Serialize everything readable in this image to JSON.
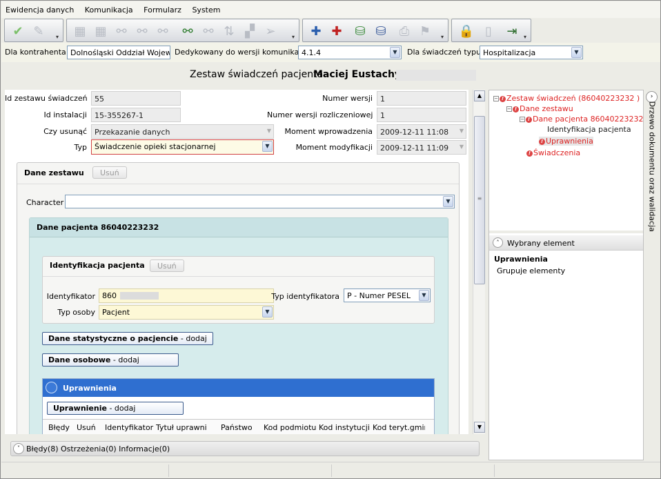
{
  "menu": [
    "Ewidencja danych",
    "Komunikacja",
    "Formularz",
    "System"
  ],
  "filter": {
    "kontrahent_label": "Dla kontrahenta:",
    "kontrahent_value": "Dolnośląski Oddział Wojewód",
    "wersja_label": "Dedykowany do wersji komunikatu:",
    "wersja_value": "4.1.4",
    "typ_label": "Dla świadczeń typu:",
    "typ_value": "Hospitalizacja"
  },
  "header": {
    "title": "Zestaw świadczeń pacjenta",
    "patient": "Maciej Eustachy"
  },
  "fields": {
    "id_zestawu_label": "Id zestawu świadczeń",
    "id_zestawu": "55",
    "id_instalacji_label": "Id instalacji",
    "id_instalacji": "15-355267-1",
    "czy_usunac_label": "Czy usunąć",
    "czy_usunac": "Przekazanie danych",
    "typ_label": "Typ",
    "typ": "Świadczenie opieki stacjonarnej",
    "numer_wersji_label": "Numer wersji",
    "numer_wersji": "1",
    "numer_wersji_rozl_label": "Numer wersji rozliczeniowej",
    "numer_wersji_rozl": "1",
    "moment_wpr_label": "Moment wprowadzenia",
    "moment_wpr": "2009-12-11 11:08",
    "moment_mod_label": "Moment modyfikacji",
    "moment_mod": "2009-12-11 11:09"
  },
  "dane_zestawu": {
    "title": "Dane zestawu",
    "delete": "Usuń",
    "character_label": "Character",
    "character_value": ""
  },
  "dane_pacjenta": {
    "title": "Dane pacjenta 86040223232"
  },
  "identyfikacja": {
    "title": "Identyfikacja pacjenta",
    "delete": "Usuń",
    "identyfikator_label": "Identyfikator",
    "identyfikator": "860",
    "typ_identyfikatora_label": "Typ identyfikatora",
    "typ_identyfikatora": "P - Numer PESEL",
    "typ_osoby_label": "Typ osoby",
    "typ_osoby": "Pacjent"
  },
  "buttons": {
    "dane_stat": "Dane statystyczne o pacjencie",
    "dane_stat_suffix": " - dodaj",
    "dane_osobowe": "Dane osobowe",
    "dane_osobowe_suffix": " - dodaj",
    "uprawnienie": "Uprawnienie",
    "uprawnienie_suffix": " - dodaj"
  },
  "uprawnienia": {
    "title": "Uprawnienia",
    "columns": [
      "Błędy",
      "Usuń",
      "Identyfikator",
      "Tytuł uprawnie",
      "Państwo",
      "Kod podmiotu",
      "Kod instytucji u",
      "Kod teryt.gmir"
    ]
  },
  "bottom": {
    "text": "Błędy(8) Ostrzeżenia(0) Informacje(0)"
  },
  "tree": {
    "n1": "Zestaw świadczeń (86040223232 )",
    "n2": "Dane zestawu",
    "n3": "Dane pacjenta 86040223232",
    "n4": "Identyfikacja pacjenta",
    "n5": "Uprawnienia",
    "n6": "Świadczenia"
  },
  "selected": {
    "header": "Wybrany element",
    "name": "Uprawnienia",
    "desc": "Grupuje elementy"
  },
  "side_tab": "Drzewo dokumentu oraz walidacja",
  "colors": {
    "error": "#dd2222",
    "accent_blue": "#2f6fd0",
    "teal_bg": "#d6ecec"
  }
}
